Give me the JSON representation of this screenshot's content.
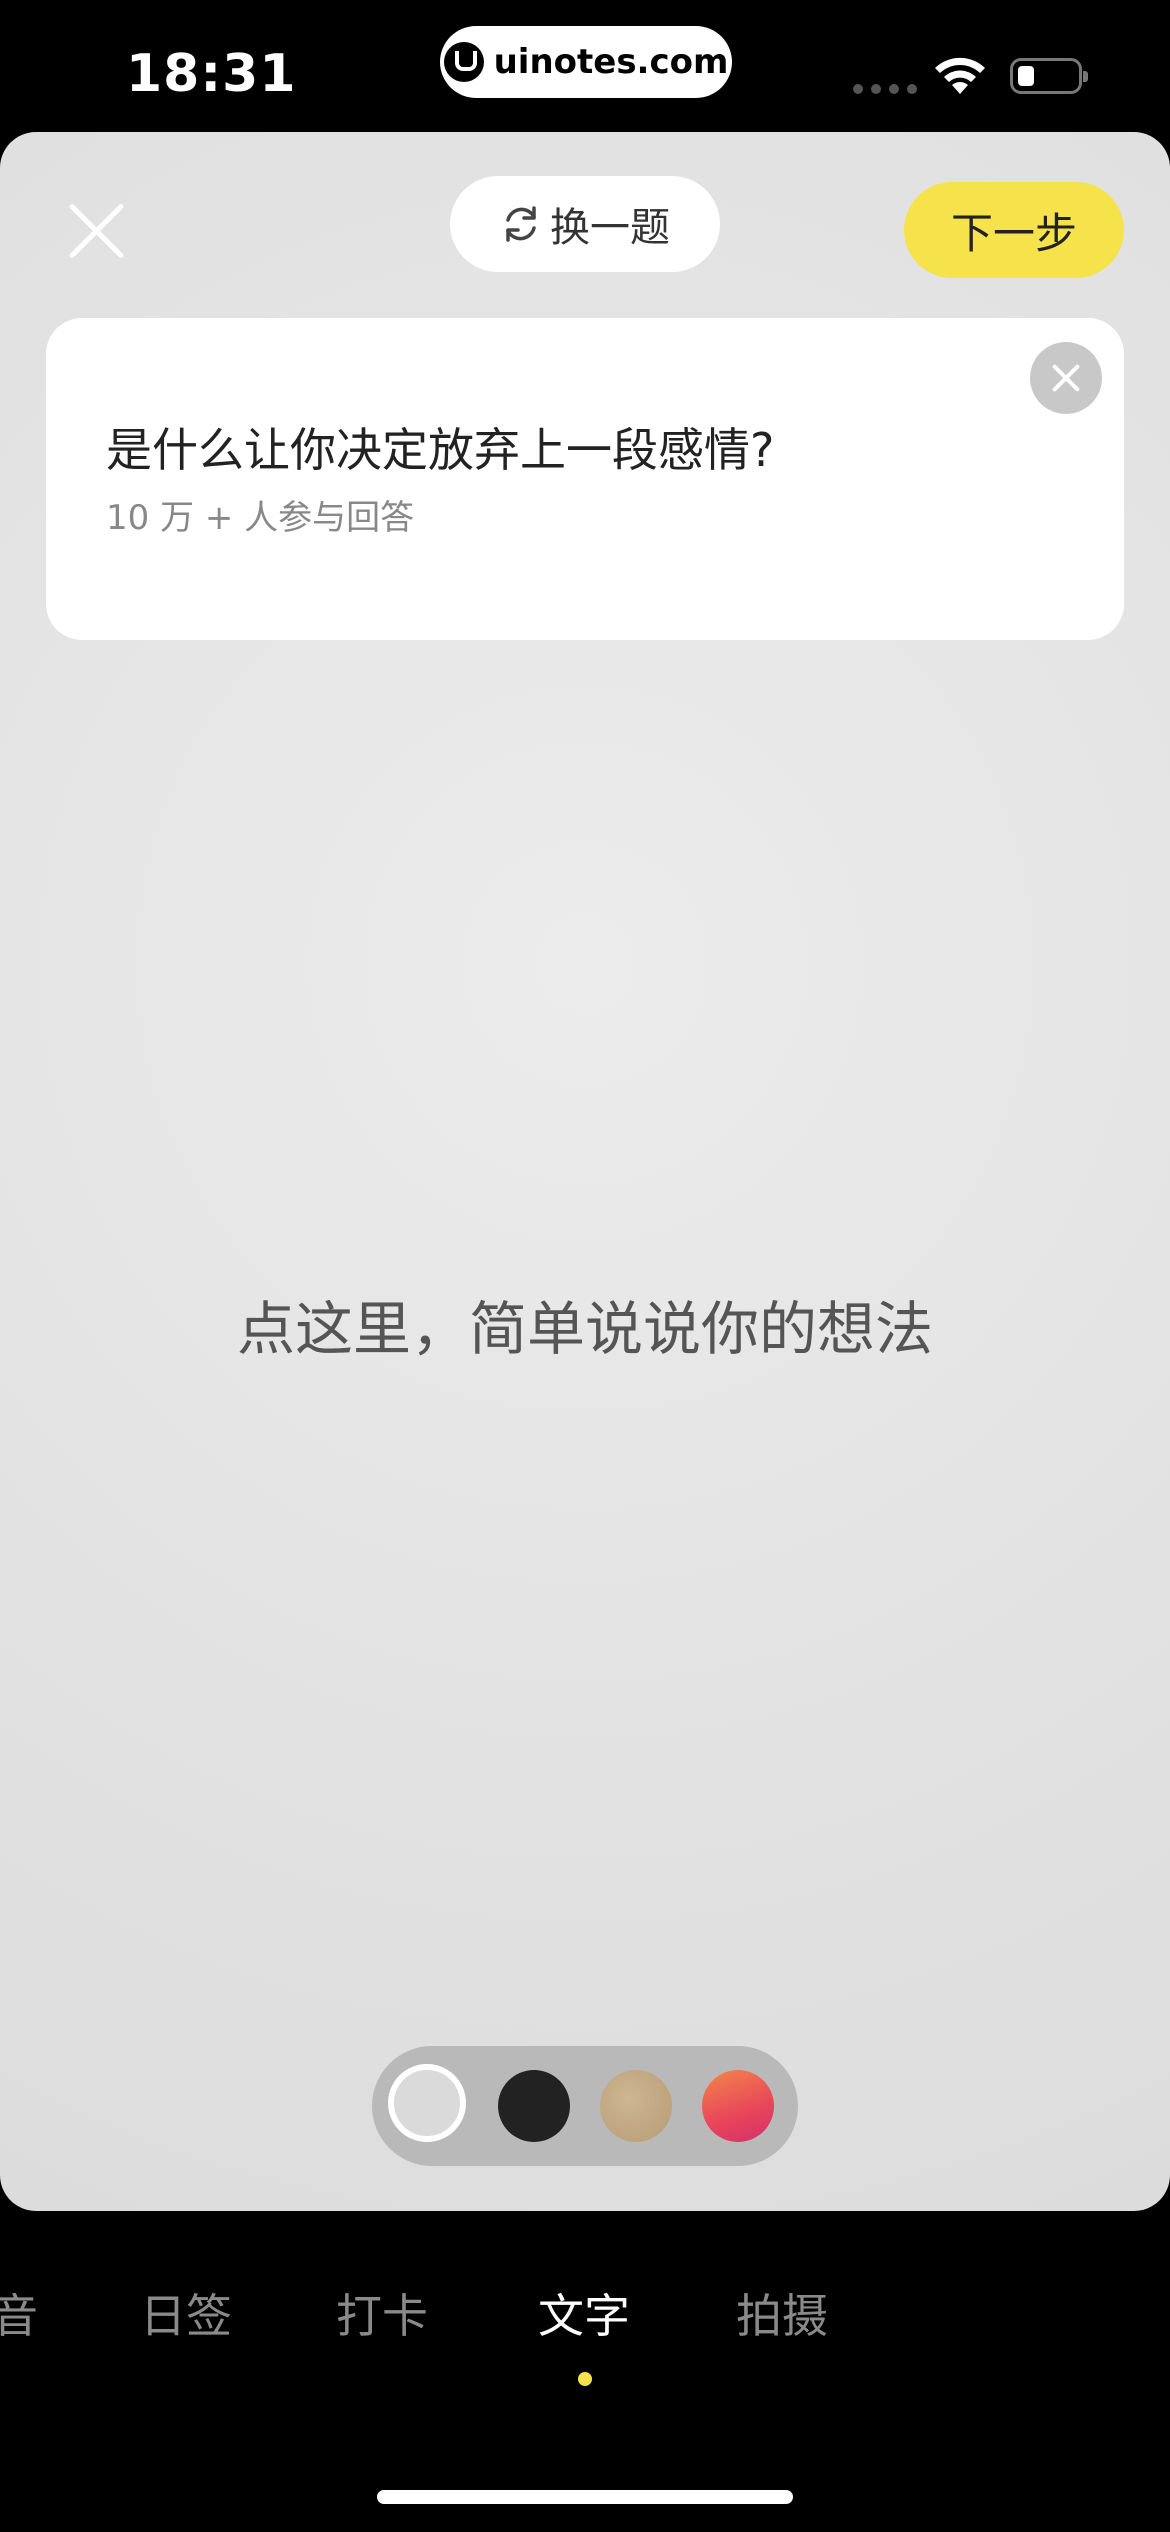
{
  "status_bar": {
    "time": "18:31",
    "url": "uinotes.com"
  },
  "toolbar": {
    "switch_label": "换一题",
    "next_label": "下一步"
  },
  "question_card": {
    "question": "是什么让你决定放弃上一段感情?",
    "participants": "10 万 + 人参与回答"
  },
  "editor": {
    "placeholder": "点这里，简单说说你的想法"
  },
  "color_swatches": [
    {
      "name": "white",
      "color": "#dadada",
      "selected": true
    },
    {
      "name": "black",
      "color": "#222222",
      "selected": false
    },
    {
      "name": "tan",
      "color": "#c3ab86",
      "selected": false
    },
    {
      "name": "gradient",
      "color": "#e8455a",
      "selected": false
    }
  ],
  "tabs": [
    {
      "label": "音",
      "active": false
    },
    {
      "label": "日签",
      "active": false
    },
    {
      "label": "打卡",
      "active": false
    },
    {
      "label": "文字",
      "active": true
    },
    {
      "label": "拍摄",
      "active": false
    }
  ],
  "colors": {
    "accent_yellow": "#f6e24b"
  }
}
